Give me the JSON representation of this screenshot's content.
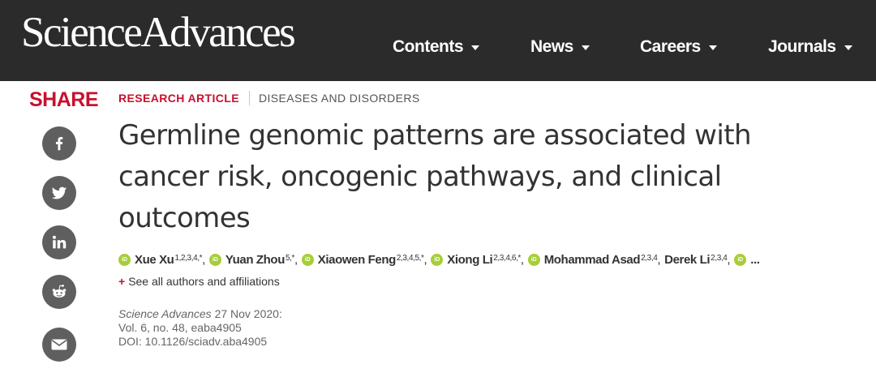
{
  "header": {
    "logo": "ScienceAdvances",
    "nav": [
      {
        "label": "Contents"
      },
      {
        "label": "News"
      },
      {
        "label": "Careers"
      },
      {
        "label": "Journals"
      }
    ]
  },
  "share": {
    "label": "SHARE",
    "buttons": [
      "facebook-icon",
      "twitter-icon",
      "linkedin-icon",
      "reddit-icon",
      "email-icon"
    ]
  },
  "article": {
    "type_tag": "RESEARCH ARTICLE",
    "subject_tag": "DISEASES AND DISORDERS",
    "title": "Germline genomic patterns are associated with cancer risk, oncogenic pathways, and clinical outcomes",
    "authors": [
      {
        "name": "Xue Xu",
        "sup": "1,2,3,4,*"
      },
      {
        "name": "Yuan Zhou",
        "sup": "5,*"
      },
      {
        "name": "Xiaowen Feng",
        "sup": "2,3,4,5,*"
      },
      {
        "name": "Xiong Li",
        "sup": "2,3,4,6,*"
      },
      {
        "name": "Mohammad Asad",
        "sup": "2,3,4"
      },
      {
        "name": "Derek Li",
        "sup": "2,3,4"
      }
    ],
    "orcid_label": "iD",
    "authors_more": "...",
    "see_all": "See all authors and affiliations",
    "see_all_prefix": "+",
    "journal": "Science Advances",
    "date": "27 Nov 2020:",
    "volume": "Vol. 6, no. 48, eaba4905",
    "doi": "DOI: 10.1126/sciadv.aba4905"
  },
  "colors": {
    "header_bg": "#2b2b2b",
    "accent_red": "#c8102e",
    "share_icon_bg": "#5f5f5f",
    "orcid_green": "#a6ce39"
  }
}
